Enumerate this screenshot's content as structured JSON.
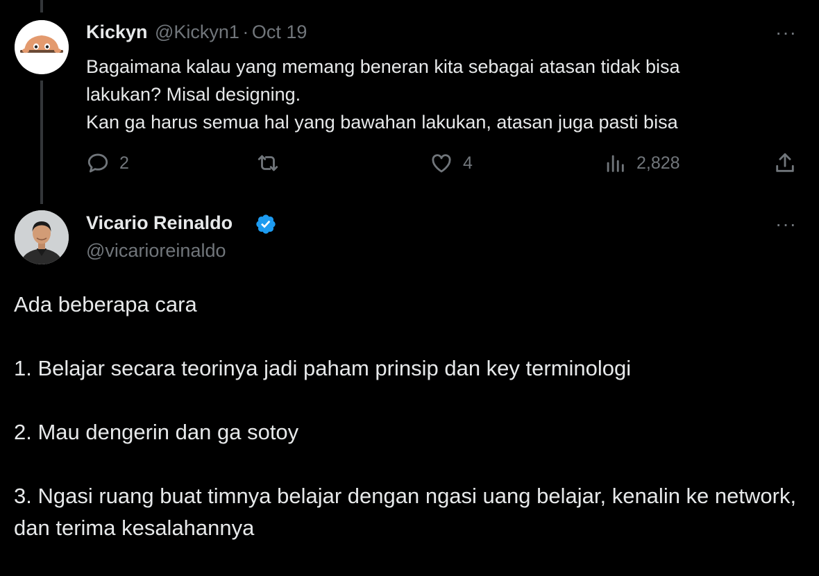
{
  "reply": {
    "display_name": "Kickyn",
    "handle": "@Kickyn1",
    "separator": "·",
    "date": "Oct 19",
    "more_label": "···",
    "text_lines": [
      "Bagaimana kalau yang memang beneran kita sebagai atasan tidak bisa",
      "lakukan? Misal designing.",
      "Kan ga harus semua hal yang bawahan lakukan, atasan juga pasti bisa"
    ],
    "stats": {
      "replies": "2",
      "likes": "4",
      "views": "2,828"
    },
    "icons": [
      "reply-icon",
      "retweet-icon",
      "like-icon",
      "views-icon",
      "share-icon"
    ]
  },
  "main": {
    "display_name": "Vicario Reinaldo",
    "handle": "@vicarioreinaldo",
    "verified": true,
    "verified_color": "#1d9bf0",
    "more_label": "···",
    "paragraphs": [
      "Ada beberapa cara",
      "1. Belajar secara teorinya jadi paham prinsip dan key terminologi",
      "2. Mau dengerin dan ga sotoy",
      "3. Ngasi ruang buat timnya belajar dengan ngasi uang belajar, kenalin ke network, dan terima kesalahannya"
    ]
  },
  "colors": {
    "background": "#000000",
    "text": "#e7e9ea",
    "muted": "#71767b",
    "thread_line": "#333639"
  }
}
